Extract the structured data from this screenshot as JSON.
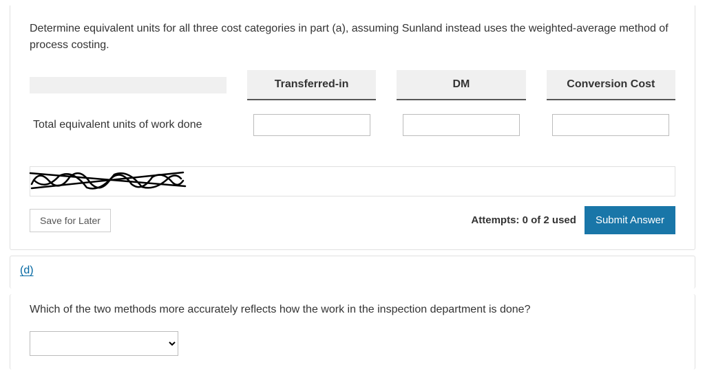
{
  "question_c": {
    "prompt": "Determine equivalent units for all three cost categories in part (a), assuming Sunland instead uses the weighted-average method of process costing.",
    "headers": {
      "transferred_in": "Transferred-in",
      "dm": "DM",
      "conversion": "Conversion Cost"
    },
    "row_label": "Total equivalent units of work done",
    "values": {
      "transferred_in": "",
      "dm": "",
      "conversion": ""
    }
  },
  "footer": {
    "save_label": "Save for Later",
    "attempts_text": "Attempts: 0 of 2 used",
    "submit_label": "Submit Answer"
  },
  "section_d": {
    "label": "(d)",
    "prompt": "Which of the two methods more accurately reflects how the work in the inspection department is done?",
    "select_value": ""
  }
}
